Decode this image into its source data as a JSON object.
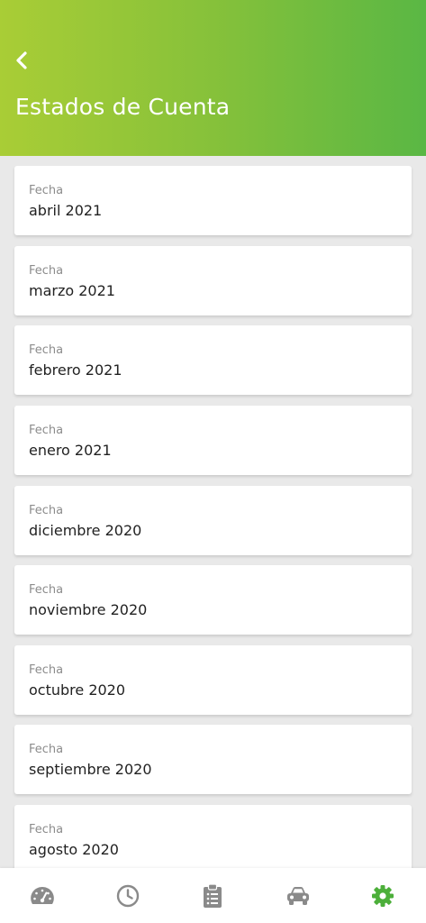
{
  "header": {
    "title": "Estados de Cuenta",
    "gradient_start": "#a9cd36",
    "gradient_end": "#5ab744"
  },
  "statements": [
    {
      "label": "Fecha",
      "value": "abril 2021"
    },
    {
      "label": "Fecha",
      "value": "marzo 2021"
    },
    {
      "label": "Fecha",
      "value": "febrero 2021"
    },
    {
      "label": "Fecha",
      "value": "enero 2021"
    },
    {
      "label": "Fecha",
      "value": "diciembre 2020"
    },
    {
      "label": "Fecha",
      "value": "noviembre 2020"
    },
    {
      "label": "Fecha",
      "value": "octubre 2020"
    },
    {
      "label": "Fecha",
      "value": "septiembre 2020"
    },
    {
      "label": "Fecha",
      "value": "agosto 2020"
    }
  ],
  "bottom_nav": {
    "items": [
      {
        "icon": "speedometer-icon",
        "active": false
      },
      {
        "icon": "clock-icon",
        "active": false
      },
      {
        "icon": "clipboard-list-icon",
        "active": false
      },
      {
        "icon": "car-icon",
        "active": false
      },
      {
        "icon": "gear-icon",
        "active": true
      }
    ],
    "inactive_color": "#8a8a8a",
    "active_color": "#4caf3a"
  }
}
